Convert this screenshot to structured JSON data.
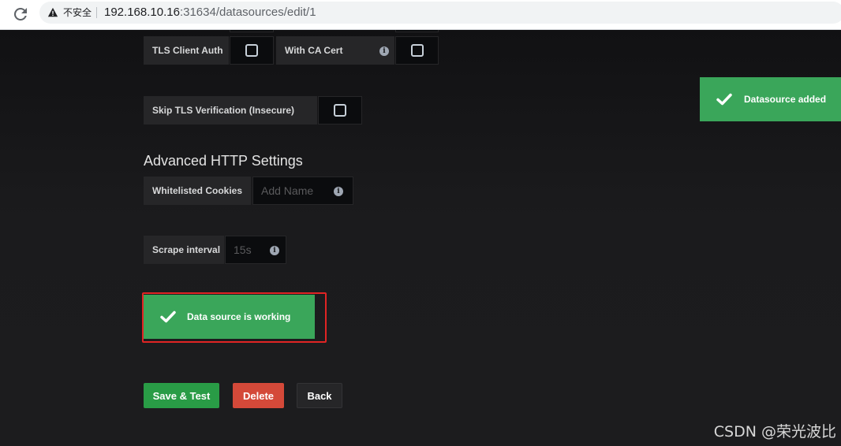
{
  "browser": {
    "security_label": "不安全",
    "url_host": "192.168.10.16",
    "url_path": ":31634/datasources/edit/1"
  },
  "form": {
    "tls_client_auth_label": "TLS Client Auth",
    "with_ca_cert_label": "With CA Cert",
    "skip_tls_label": "Skip TLS Verification (Insecure)",
    "advanced_title": "Advanced HTTP Settings",
    "whitelisted_cookies_label": "Whitelisted Cookies",
    "whitelisted_cookies_placeholder": "Add Name",
    "scrape_interval_label": "Scrape interval",
    "scrape_interval_placeholder": "15s"
  },
  "alerts": {
    "test_result": "Data source is working",
    "toast": "Datasource added"
  },
  "actions": {
    "save_test": "Save & Test",
    "delete": "Delete",
    "back": "Back"
  },
  "watermark": "CSDN @荣光波比",
  "colors": {
    "success": "#3aa65a",
    "danger": "#d44939",
    "primary": "#299c46",
    "highlight": "#e02424"
  }
}
